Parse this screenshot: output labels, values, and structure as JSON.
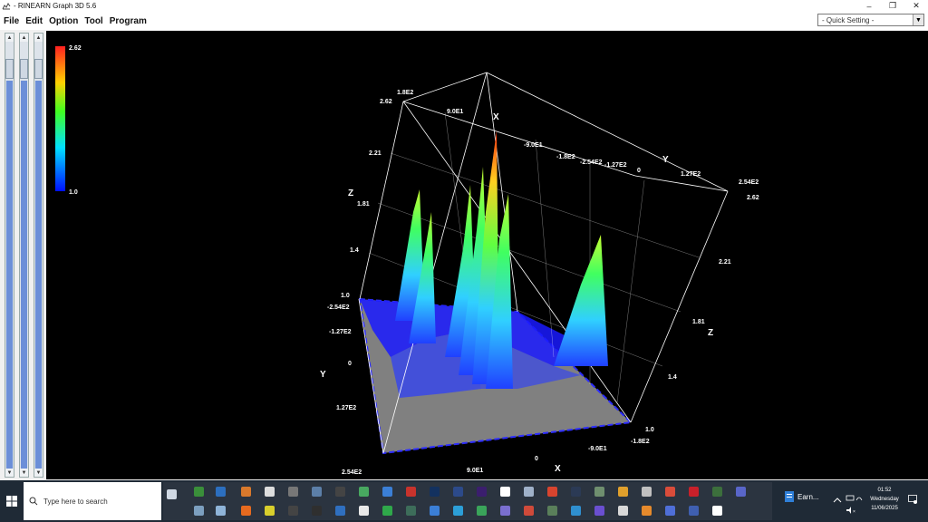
{
  "window": {
    "title": "- RINEARN Graph 3D 5.6",
    "minimize": "–",
    "restore": "❐",
    "close": "✕"
  },
  "menu": [
    "File",
    "Edit",
    "Option",
    "Tool",
    "Program"
  ],
  "quick_setting": "- Quick Setting -",
  "colorbar": {
    "max": "2.62",
    "min": "1.0"
  },
  "axes": {
    "x_label": "X",
    "y_label": "Y",
    "z_label": "Z",
    "labels": [
      {
        "text": "1.8E2",
        "pos": "top-back"
      },
      {
        "text": "2.62",
        "pos": "z-back-top"
      },
      {
        "text": "9.0E1",
        "pos": "x-back"
      },
      {
        "text": "-9.0E1",
        "pos": "x-back"
      },
      {
        "text": "-1.8E2",
        "pos": "x-back"
      },
      {
        "text": "-2.54E2",
        "pos": "y-back"
      },
      {
        "text": "-1.27E2",
        "pos": "y-back"
      },
      {
        "text": "0",
        "pos": "y-back"
      },
      {
        "text": "1.27E2",
        "pos": "y-back"
      },
      {
        "text": "2.54E2",
        "pos": "y-back"
      },
      {
        "text": "2.62",
        "pos": "z-right-top"
      },
      {
        "text": "2.21",
        "pos": "z-left"
      },
      {
        "text": "1.81",
        "pos": "z-left"
      },
      {
        "text": "1.4",
        "pos": "z-left"
      },
      {
        "text": "1.0",
        "pos": "z-left"
      },
      {
        "text": "-2.54E2",
        "pos": "y-front"
      },
      {
        "text": "-1.27E2",
        "pos": "y-front"
      },
      {
        "text": "0",
        "pos": "y-front"
      },
      {
        "text": "1.27E2",
        "pos": "y-front"
      },
      {
        "text": "2.54E2",
        "pos": "y-front"
      },
      {
        "text": "2.21",
        "pos": "z-right"
      },
      {
        "text": "1.81",
        "pos": "z-right"
      },
      {
        "text": "1.4",
        "pos": "z-right"
      },
      {
        "text": "1.0",
        "pos": "z-right"
      },
      {
        "text": "-1.8E2",
        "pos": "x-front"
      },
      {
        "text": "-9.0E1",
        "pos": "x-front"
      },
      {
        "text": "0",
        "pos": "x-front"
      },
      {
        "text": "9.0E1",
        "pos": "x-front"
      }
    ]
  },
  "taskbar": {
    "search_placeholder": "Type here to search",
    "task_app_label": "Earn...",
    "clock_time": "01:52",
    "clock_day": "Wednesday",
    "clock_date": "11/06/2025"
  },
  "colors": {
    "canvas_bg": "#000000",
    "floor": "#808080",
    "grid": "#ffffff",
    "surface_base": "#1a1aff",
    "colorbar_top": "#ff2a1a",
    "colorbar_bottom": "#0000ff"
  }
}
